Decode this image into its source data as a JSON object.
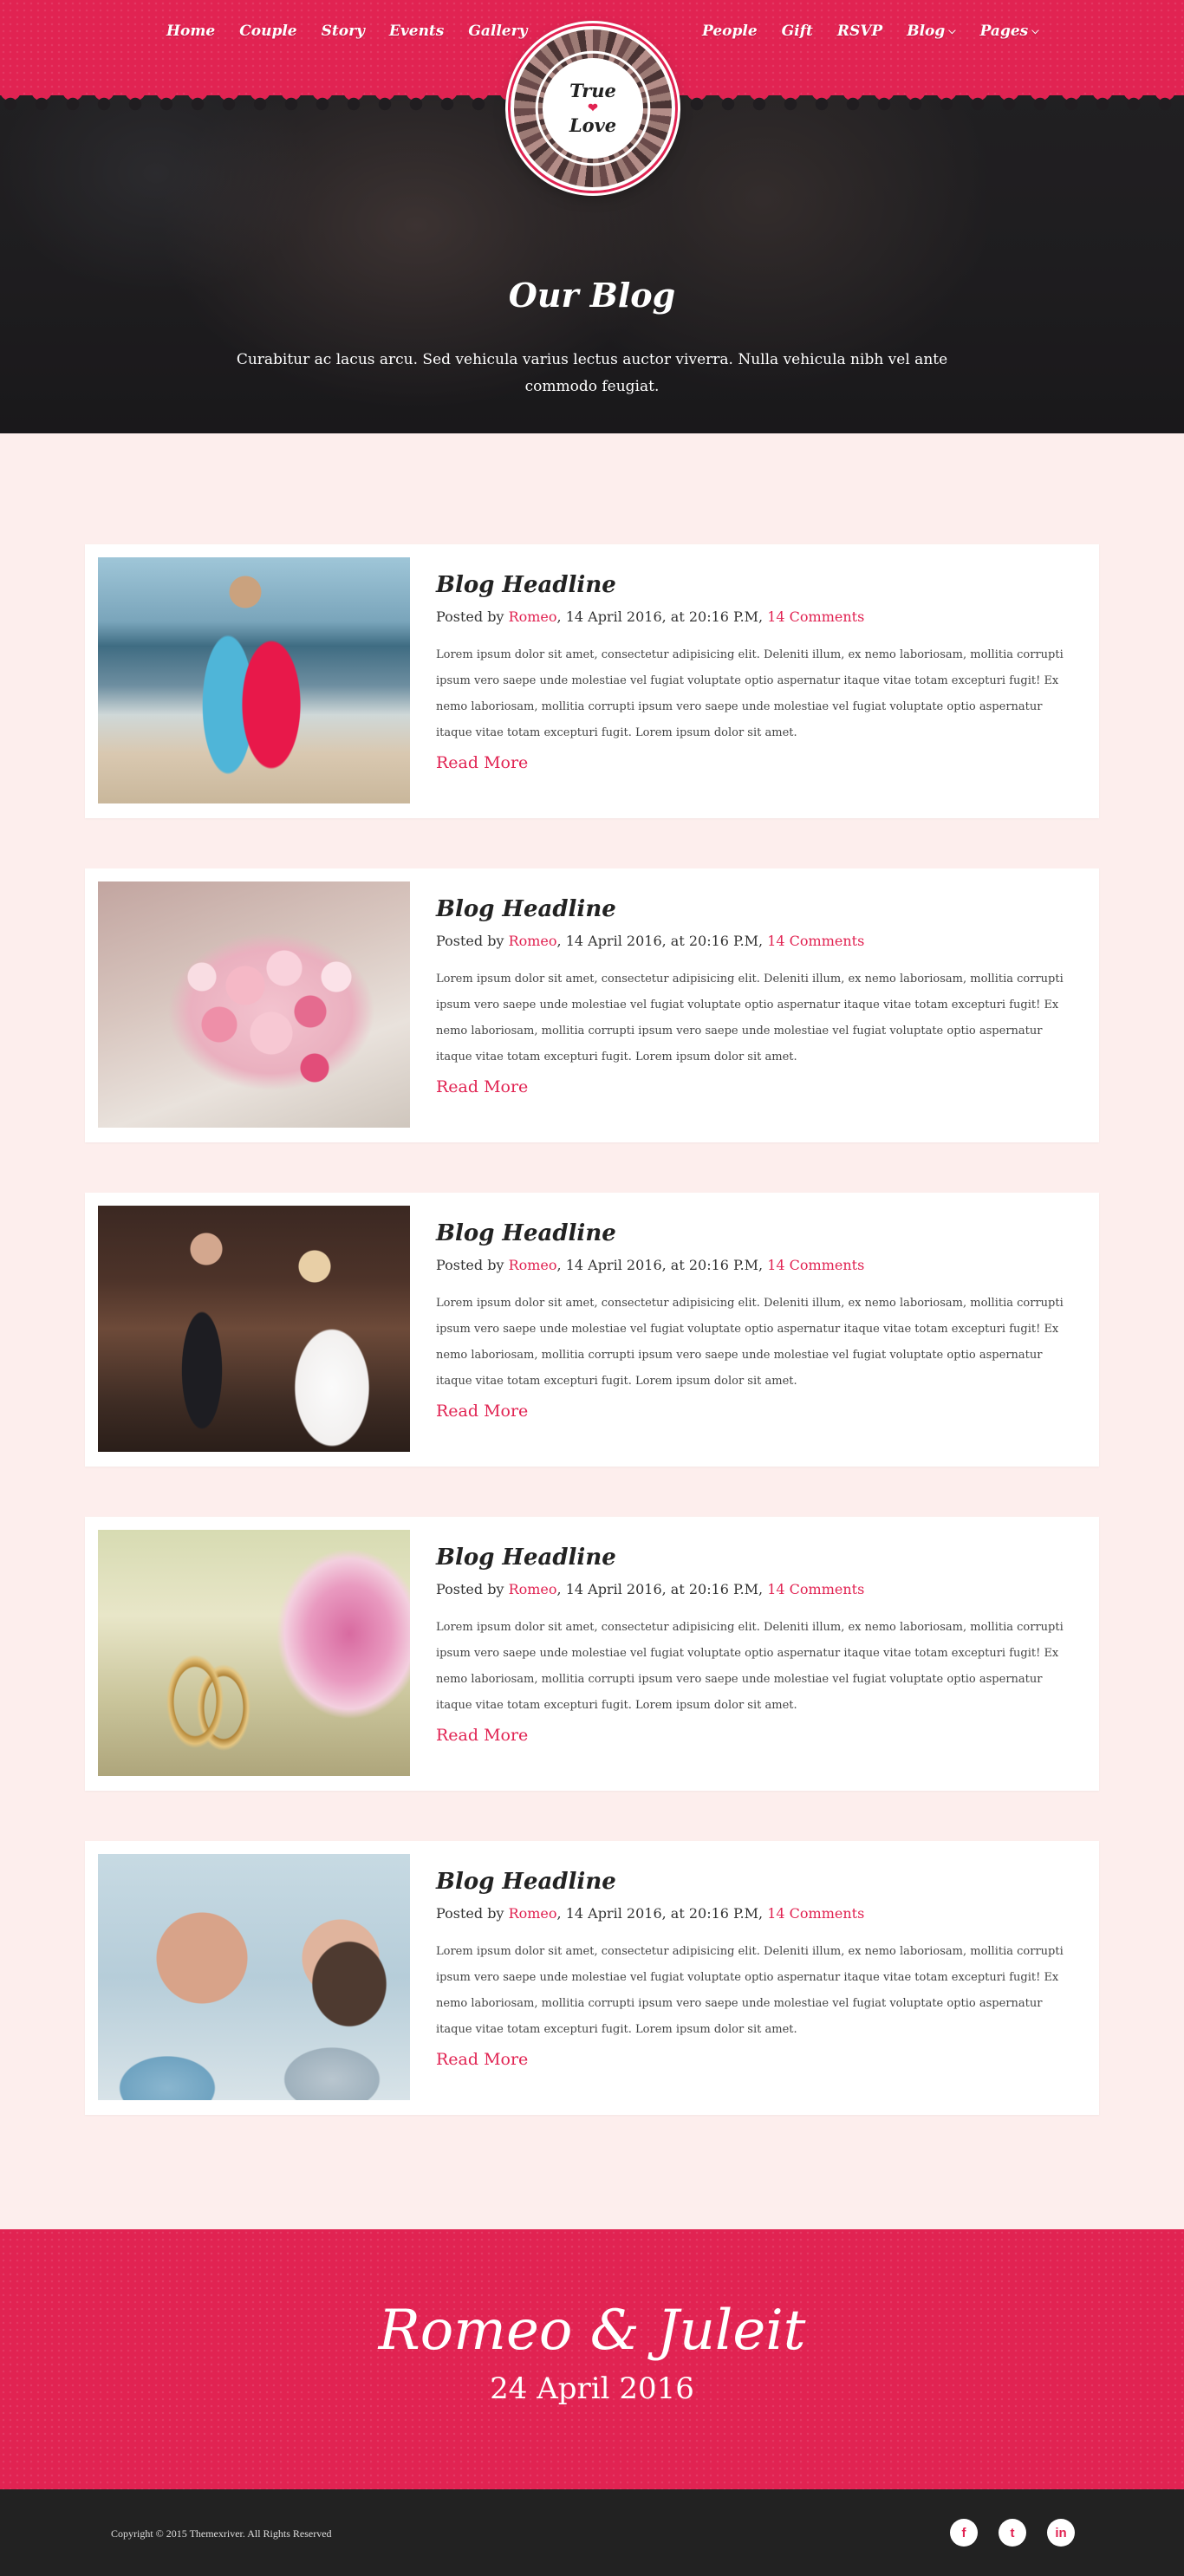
{
  "nav": {
    "left": [
      "Home",
      "Couple",
      "Story",
      "Events",
      "Gallery"
    ],
    "right": [
      {
        "label": "People",
        "dropdown": false
      },
      {
        "label": "Gift",
        "dropdown": false
      },
      {
        "label": "RSVP",
        "dropdown": false
      },
      {
        "label": "Blog",
        "dropdown": true
      },
      {
        "label": "Pages",
        "dropdown": true
      }
    ]
  },
  "logo": {
    "line1": "True",
    "heart": "❤",
    "line2": "Love"
  },
  "hero": {
    "title": "Our Blog",
    "subtitle": "Curabitur ac lacus arcu. Sed vehicula varius lectus auctor viverra. Nulla vehicula nibh vel ante commodo feugiat."
  },
  "posts": [
    {
      "image": "beach-couple-photo",
      "title": "Blog Headline",
      "meta": {
        "prefix": "Posted by",
        "author": "Romeo",
        "date": ", 14 April 2016, at 20:16 P.M,",
        "comments": "14 Comments"
      },
      "excerpt": "Lorem ipsum dolor sit amet, consectetur adipisicing elit. Deleniti illum, ex nemo laboriosam, mollitia corrupti ipsum vero saepe unde molestiae vel fugiat voluptate optio aspernatur itaque vitae totam excepturi fugit! Ex nemo laboriosam, mollitia corrupti ipsum vero saepe unde molestiae vel fugiat voluptate optio aspernatur itaque vitae totam excepturi fugit. Lorem ipsum dolor sit amet.",
      "read_more": "Read More"
    },
    {
      "image": "rose-bouquet-photo",
      "title": "Blog Headline",
      "meta": {
        "prefix": "Posted by",
        "author": "Romeo",
        "date": ", 14 April 2016, at 20:16 P.M,",
        "comments": "14 Comments"
      },
      "excerpt": "Lorem ipsum dolor sit amet, consectetur adipisicing elit. Deleniti illum, ex nemo laboriosam, mollitia corrupti ipsum vero saepe unde molestiae vel fugiat voluptate optio aspernatur itaque vitae totam excepturi fugit! Ex nemo laboriosam, mollitia corrupti ipsum vero saepe unde molestiae vel fugiat voluptate optio aspernatur itaque vitae totam excepturi fugit. Lorem ipsum dolor sit amet.",
      "read_more": "Read More"
    },
    {
      "image": "wedding-couple-photo",
      "title": "Blog Headline",
      "meta": {
        "prefix": "Posted by",
        "author": "Romeo",
        "date": ", 14 April 2016, at 20:16 P.M,",
        "comments": "14 Comments"
      },
      "excerpt": "Lorem ipsum dolor sit amet, consectetur adipisicing elit. Deleniti illum, ex nemo laboriosam, mollitia corrupti ipsum vero saepe unde molestiae vel fugiat voluptate optio aspernatur itaque vitae totam excepturi fugit! Ex nemo laboriosam, mollitia corrupti ipsum vero saepe unde molestiae vel fugiat voluptate optio aspernatur itaque vitae totam excepturi fugit. Lorem ipsum dolor sit amet.",
      "read_more": "Read More"
    },
    {
      "image": "wedding-rings-photo",
      "title": "Blog Headline",
      "meta": {
        "prefix": "Posted by",
        "author": "Romeo",
        "date": ", 14 April 2016, at 20:16 P.M,",
        "comments": "14 Comments"
      },
      "excerpt": "Lorem ipsum dolor sit amet, consectetur adipisicing elit. Deleniti illum, ex nemo laboriosam, mollitia corrupti ipsum vero saepe unde molestiae vel fugiat voluptate optio aspernatur itaque vitae totam excepturi fugit! Ex nemo laboriosam, mollitia corrupti ipsum vero saepe unde molestiae vel fugiat voluptate optio aspernatur itaque vitae totam excepturi fugit. Lorem ipsum dolor sit amet.",
      "read_more": "Read More"
    },
    {
      "image": "kissing-couple-photo",
      "title": "Blog Headline",
      "meta": {
        "prefix": "Posted by",
        "author": "Romeo",
        "date": ", 14 April 2016, at 20:16 P.M,",
        "comments": "14 Comments"
      },
      "excerpt": "Lorem ipsum dolor sit amet, consectetur adipisicing elit. Deleniti illum, ex nemo laboriosam, mollitia corrupti ipsum vero saepe unde molestiae vel fugiat voluptate optio aspernatur itaque vitae totam excepturi fugit! Ex nemo laboriosam, mollitia corrupti ipsum vero saepe unde molestiae vel fugiat voluptate optio aspernatur itaque vitae totam excepturi fugit. Lorem ipsum dolor sit amet.",
      "read_more": "Read More"
    }
  ],
  "event": {
    "names": "Romeo & Juleit",
    "date": "24 April 2016"
  },
  "footer": {
    "copyright": "Copyright © 2015 Themexriver. All Rights Reserved",
    "social": [
      {
        "icon": "facebook-icon",
        "glyph": "f"
      },
      {
        "icon": "twitter-icon",
        "glyph": "t"
      },
      {
        "icon": "linkedin-icon",
        "glyph": "in"
      }
    ]
  },
  "colors": {
    "accent": "#e12352",
    "page_bg": "#fdeeed",
    "footer_bg": "#222222"
  }
}
